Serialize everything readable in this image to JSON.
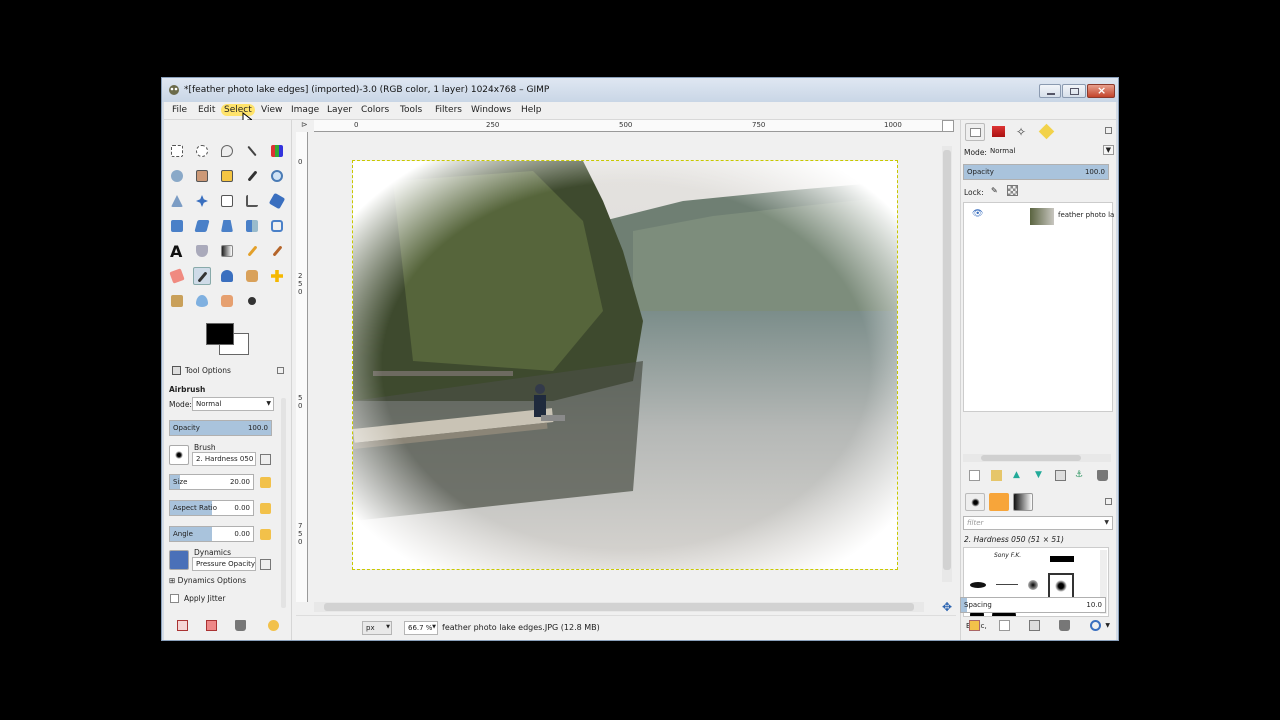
{
  "window": {
    "title": "*[feather photo lake edges] (imported)-3.0 (RGB color, 1 layer) 1024x768 – GIMP"
  },
  "menubar": [
    "File",
    "Edit",
    "Select",
    "View",
    "Image",
    "Layer",
    "Colors",
    "Tools",
    "Filters",
    "Windows",
    "Help"
  ],
  "rulers": {
    "h": [
      "0",
      "250",
      "500",
      "750",
      "1000"
    ],
    "v": [
      "0",
      "2",
      "5",
      "0",
      "5",
      "0",
      "7",
      "5",
      "0"
    ]
  },
  "tool_options": {
    "tab_label": "Tool Options",
    "tool_name": "Airbrush",
    "mode_label": "Mode:",
    "mode_value": "Normal",
    "opacity": {
      "label": "Opacity",
      "value": "100.0",
      "fraction": 1.0
    },
    "brush_label": "Brush",
    "brush_value": "2. Hardness 050",
    "size": {
      "label": "Size",
      "value": "20.00",
      "fraction": 0.12
    },
    "aspect_ratio": {
      "label": "Aspect Ratio",
      "value": "0.00",
      "fraction": 0.5
    },
    "angle": {
      "label": "Angle",
      "value": "0.00",
      "fraction": 0.5
    },
    "dynamics_label": "Dynamics",
    "dynamics_value": "Pressure Opacity",
    "dynamics_options": "Dynamics Options",
    "apply_jitter": "Apply Jitter"
  },
  "status": {
    "unit": "px",
    "zoom": "66.7 %",
    "file_info": "feather photo lake edges.JPG (12.8 MB)"
  },
  "layers": {
    "mode_label": "Mode:",
    "mode_value": "Normal",
    "opacity_label": "Opacity",
    "opacity_value": "100.0",
    "lock_label": "Lock:",
    "layer_name": "feather photo la"
  },
  "brushes": {
    "filter_placeholder": "filter",
    "current_brush": "2. Hardness 050 (51 × 51)",
    "preset": "Basic,",
    "spacing_label": "Spacing",
    "spacing_value": "10.0",
    "sample_text": "Sony F.K."
  },
  "colors": {
    "accent": "#ffe36b",
    "slider_fill": "#a9c3dc",
    "selection_dash": "#c8c800"
  }
}
